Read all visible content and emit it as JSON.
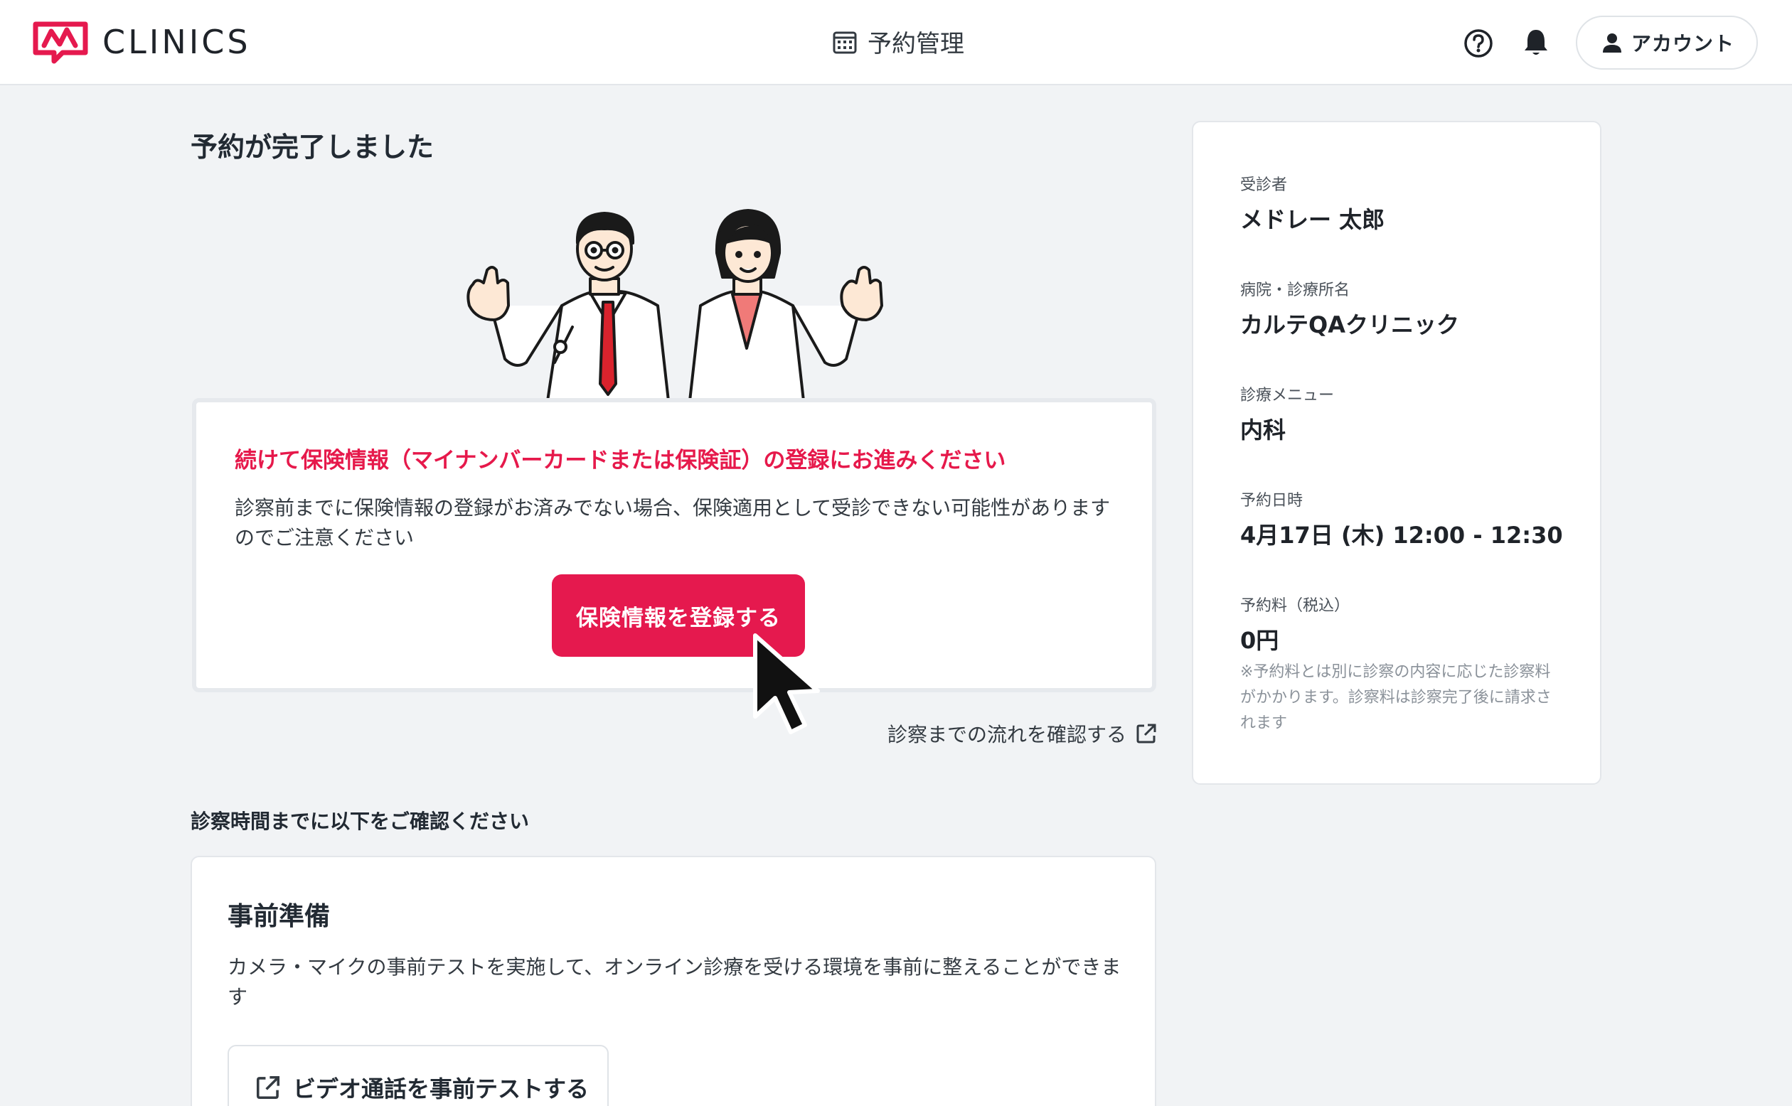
{
  "header": {
    "brand": "CLINICS",
    "nav_label": "予約管理",
    "account_label": "アカウント"
  },
  "page_title": "予約が完了しました",
  "notice": {
    "title": "続けて保険情報（マイナンバーカードまたは保険証）の登録にお進みください",
    "body": "診察前までに保険情報の登録がお済みでない場合、保険適用として受診できない可能性がありますのでご注意ください",
    "cta_label": "保険情報を登録する"
  },
  "flow_link_label": "診察までの流れを確認する",
  "section_heading": "診察時間までに以下をご確認ください",
  "prep": {
    "title": "事前準備",
    "body": "カメラ・マイクの事前テストを実施して、オンライン診療を受ける環境を事前に整えることができます",
    "button_label": "ビデオ通話を事前テストする"
  },
  "summary": {
    "patient_label": "受診者",
    "patient_value": "メドレー 太郎",
    "clinic_label": "病院・診療所名",
    "clinic_value": "カルテQAクリニック",
    "menu_label": "診療メニュー",
    "menu_value": "内科",
    "datetime_label": "予約日時",
    "datetime_value": "4月17日 (木) 12:00 - 12:30",
    "fee_label": "予約料（税込）",
    "fee_value": "0円",
    "fee_note": "※予約料とは別に診察の内容に応じた診察料がかかります。診察料は診察完了後に請求されます"
  },
  "icons": {
    "logo": "clinics-logo-icon",
    "calendar": "calendar-icon",
    "help": "help-icon",
    "bell": "bell-icon",
    "user": "user-icon",
    "external": "external-link-icon",
    "cursor": "mouse-pointer-icon"
  },
  "colors": {
    "accent": "#e5194e",
    "background": "#f1f3f5",
    "card": "#ffffff"
  }
}
